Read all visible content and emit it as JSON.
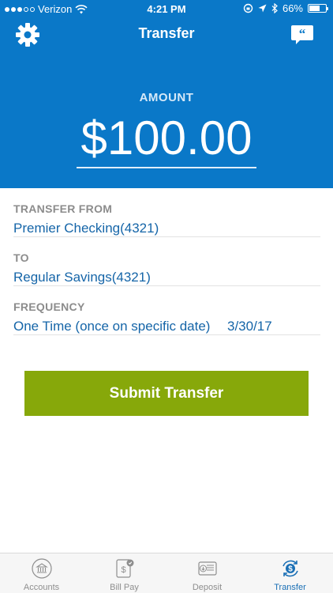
{
  "status_bar": {
    "carrier": "Verizon",
    "time": "4:21 PM",
    "battery": "66%",
    "battery_level": 0.66,
    "signal_bars_filled": 3,
    "signal_bars_total": 5
  },
  "nav": {
    "title": "Transfer",
    "left_icon": "gear-icon",
    "right_icon": "chat-quote-icon"
  },
  "amount": {
    "label": "AMOUNT",
    "value": "$100.00"
  },
  "form": {
    "from": {
      "label": "TRANSFER FROM",
      "value": "Premier Checking(4321)"
    },
    "to": {
      "label": "TO",
      "value": "Regular Savings(4321)"
    },
    "frequency": {
      "label": "FREQUENCY",
      "value": "One Time (once on specific date)",
      "date": "3/30/17"
    }
  },
  "submit": {
    "label": "Submit Transfer"
  },
  "tabbar": {
    "tabs": [
      {
        "label": "Accounts",
        "icon": "bank-icon",
        "active": false
      },
      {
        "label": "Bill Pay",
        "icon": "bill-pay-icon",
        "active": false
      },
      {
        "label": "Deposit",
        "icon": "deposit-icon",
        "active": false
      },
      {
        "label": "Transfer",
        "icon": "transfer-icon",
        "active": true
      }
    ]
  },
  "colors": {
    "header_blue": "#0a78c8",
    "link_blue": "#1565a8",
    "submit_green": "#87a80a",
    "tab_active": "#1a6fb5",
    "tab_inactive": "#8e8e8e"
  }
}
